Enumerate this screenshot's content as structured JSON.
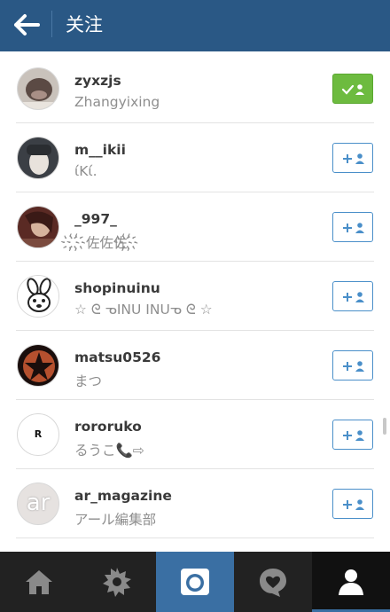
{
  "header": {
    "title": "关注"
  },
  "users": [
    {
      "username": "zyxzjs",
      "fullname": "Zhangyixing",
      "following": true
    },
    {
      "username": "m__ikii",
      "fullname": "ίΚί.",
      "following": false
    },
    {
      "username": "_997_",
      "fullname": "҉҉佐佐佐҉҉",
      "following": false
    },
    {
      "username": "shopinuinu",
      "fullname": "☆ ᘓ ᓀINU INUᓀ ᘓ ☆",
      "following": false
    },
    {
      "username": "matsu0526",
      "fullname": "まつ",
      "following": false
    },
    {
      "username": "rororuko",
      "fullname": "るうこ📞⇨",
      "following": false,
      "avatar_text": "R"
    },
    {
      "username": "ar_magazine",
      "fullname": "アール編集部",
      "following": false,
      "avatar_text": "ar"
    }
  ],
  "tabs": [
    {
      "icon": "home-icon"
    },
    {
      "icon": "explore-icon"
    },
    {
      "icon": "camera-icon"
    },
    {
      "icon": "activity-icon"
    },
    {
      "icon": "profile-icon",
      "active": true
    }
  ],
  "colors": {
    "header": "#2a5885",
    "follow_border": "#4a8fc9",
    "following_bg": "#6dbb3f",
    "tabbar": "#222222",
    "camera_tab": "#3a6fa3"
  }
}
